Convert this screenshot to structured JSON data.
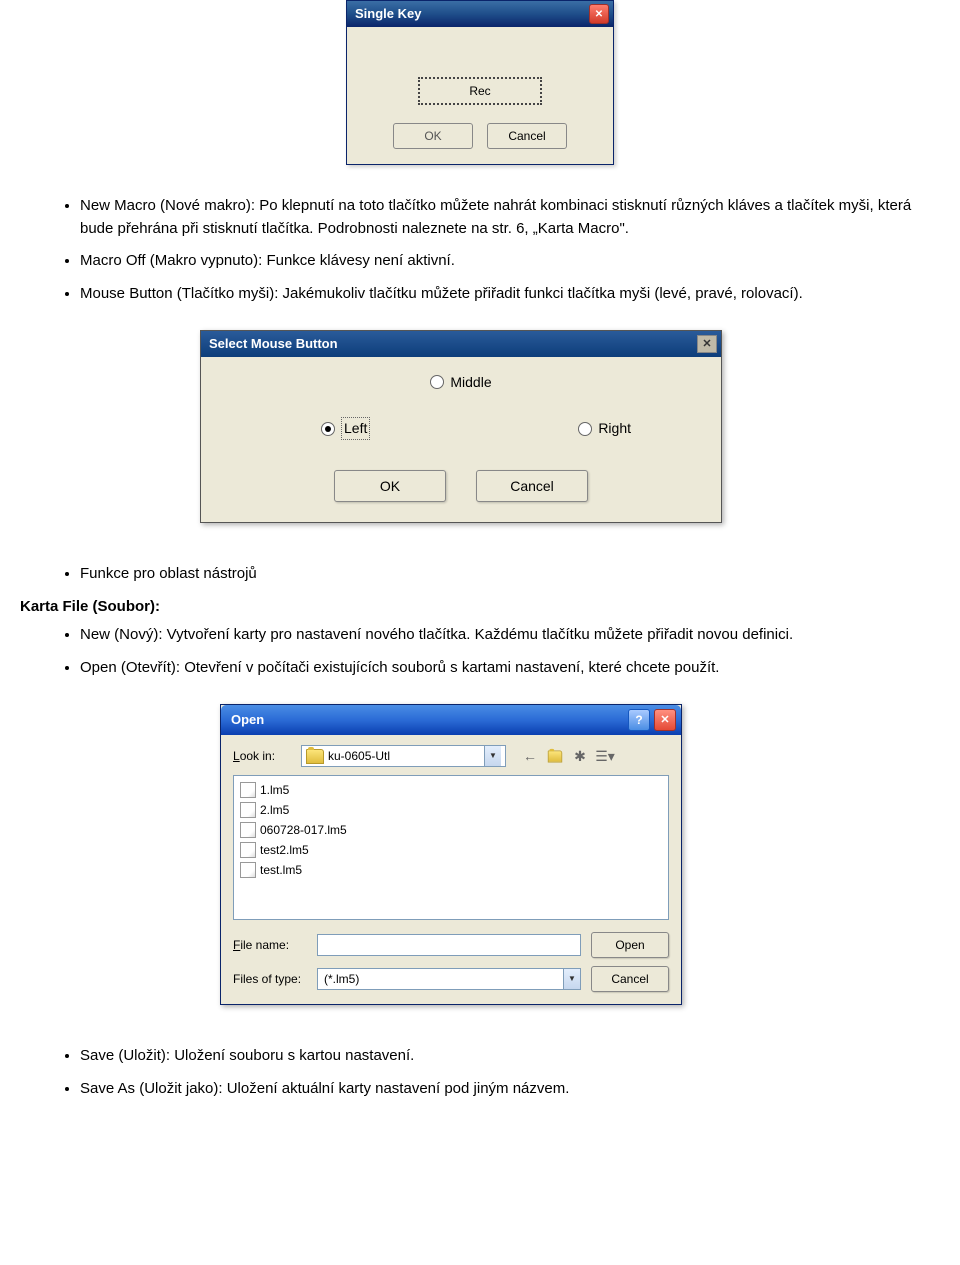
{
  "singleKey": {
    "title": "Single Key",
    "recLabel": "Rec",
    "okLabel": "OK",
    "cancelLabel": "Cancel"
  },
  "bullets1": {
    "b1": "New Macro (Nové makro): Po klepnutí na toto tlačítko můžete nahrát kombinaci stisknutí různých kláves a tlačítek myši, která bude přehrána při stisknutí tlačítka. Podrobnosti naleznete na str. 6, „Karta Macro\".",
    "b2": "Macro Off (Makro vypnuto): Funkce klávesy není aktivní.",
    "b3": "Mouse Button (Tlačítko myši): Jakémukoliv tlačítku můžete přiřadit funkci tlačítka myši (levé, pravé, rolovací)."
  },
  "smb": {
    "title": "Select Mouse Button",
    "middle": "Middle",
    "left": "Left",
    "right": "Right",
    "ok": "OK",
    "cancel": "Cancel"
  },
  "bullets2": {
    "funkce": "Funkce pro oblast nástrojů",
    "heading": "Karta File (Soubor):",
    "new": "New (Nový): Vytvoření karty pro nastavení nového tlačítka. Každému tlačítku můžete přiřadit novou definici.",
    "open": "Open (Otevřít): Otevření v počítači existujících souborů s kartami nastavení, které chcete použít."
  },
  "openDialog": {
    "title": "Open",
    "lookIn": "Look in:",
    "folder": "ku-0605-Utl",
    "files": [
      "1.lm5",
      "2.lm5",
      "060728-017.lm5",
      "test2.lm5",
      "test.lm5"
    ],
    "fileNameLabel": "File name:",
    "filesOfTypeLabel": "Files of type:",
    "filterValue": "(*.lm5)",
    "openBtn": "Open",
    "cancelBtn": "Cancel"
  },
  "bullets3": {
    "save": "Save (Uložit): Uložení souboru s kartou nastavení.",
    "saveAs": "Save As (Uložit jako): Uložení aktuální karty nastavení pod jiným názvem."
  }
}
